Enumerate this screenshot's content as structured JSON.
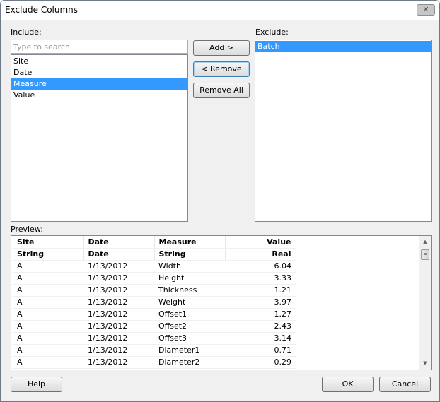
{
  "window": {
    "title": "Exclude Columns",
    "close_symbol": "✕"
  },
  "include": {
    "label": "Include:",
    "search_placeholder": "Type to search",
    "items": [
      "Site",
      "Date",
      "Measure",
      "Value"
    ],
    "selected_index": 2
  },
  "exclude": {
    "label": "Exclude:",
    "items": [
      "Batch"
    ],
    "selected_index": 0
  },
  "buttons": {
    "add": "Add >",
    "remove": "< Remove",
    "remove_all": "Remove All",
    "help": "Help",
    "ok": "OK",
    "cancel": "Cancel"
  },
  "preview": {
    "label": "Preview:",
    "headers": [
      "Site",
      "Date",
      "Measure",
      "Value"
    ],
    "types": [
      "String",
      "Date",
      "String",
      "Real"
    ],
    "rows": [
      [
        "A",
        "1/13/2012",
        "Width",
        "6.04"
      ],
      [
        "A",
        "1/13/2012",
        "Height",
        "3.33"
      ],
      [
        "A",
        "1/13/2012",
        "Thickness",
        "1.21"
      ],
      [
        "A",
        "1/13/2012",
        "Weight",
        "3.97"
      ],
      [
        "A",
        "1/13/2012",
        "Offset1",
        "1.27"
      ],
      [
        "A",
        "1/13/2012",
        "Offset2",
        "2.43"
      ],
      [
        "A",
        "1/13/2012",
        "Offset3",
        "3.14"
      ],
      [
        "A",
        "1/13/2012",
        "Diameter1",
        "0.71"
      ],
      [
        "A",
        "1/13/2012",
        "Diameter2",
        "0.29"
      ]
    ]
  },
  "icons": {
    "scroll_up": "▲",
    "scroll_down": "▼"
  }
}
